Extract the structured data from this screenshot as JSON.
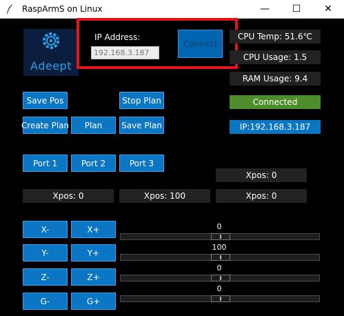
{
  "window": {
    "title": "RaspArmS on Linux",
    "minimize": "—",
    "maximize": "☐",
    "close": "✕"
  },
  "logo": {
    "text": "Adeept"
  },
  "connection": {
    "ip_label": "IP Address:",
    "ip_value": "192.168.3.187",
    "connect_label": "Connect"
  },
  "status": {
    "cpu_temp": "CPU Temp: 51.6℃",
    "cpu_usage": "CPU Usage: 1.5",
    "ram_usage": "RAM Usage: 9.4",
    "connected": "Connected",
    "ip": "IP:192.168.3.187"
  },
  "buttons": {
    "save_pos": "Save Pos",
    "stop_plan": "Stop Plan",
    "create_plan": "Create Plan",
    "plan": "Plan",
    "save_plan": "Save Plan",
    "port1": "Port 1",
    "port2": "Port 2",
    "port3": "Port 3",
    "x_minus": "X-",
    "x_plus": "X+",
    "y_minus": "Y-",
    "y_plus": "Y+",
    "z_minus": "Z-",
    "z_plus": "Z+",
    "g_minus": "G-",
    "g_plus": "G+"
  },
  "positions": {
    "upper": "Xpos: 0",
    "port1": "Xpos: 0",
    "port2": "Xpos: 100",
    "port3": "Xpos: 0"
  },
  "sliders": [
    {
      "value": 0,
      "label": "0"
    },
    {
      "value": 100,
      "label": "100"
    },
    {
      "value": 0,
      "label": "0"
    },
    {
      "value": 0,
      "label": "0"
    }
  ],
  "colors": {
    "accent_blue": "#0a76c4",
    "connected_green": "#4d8d2c",
    "highlight_red": "#e8141d"
  }
}
